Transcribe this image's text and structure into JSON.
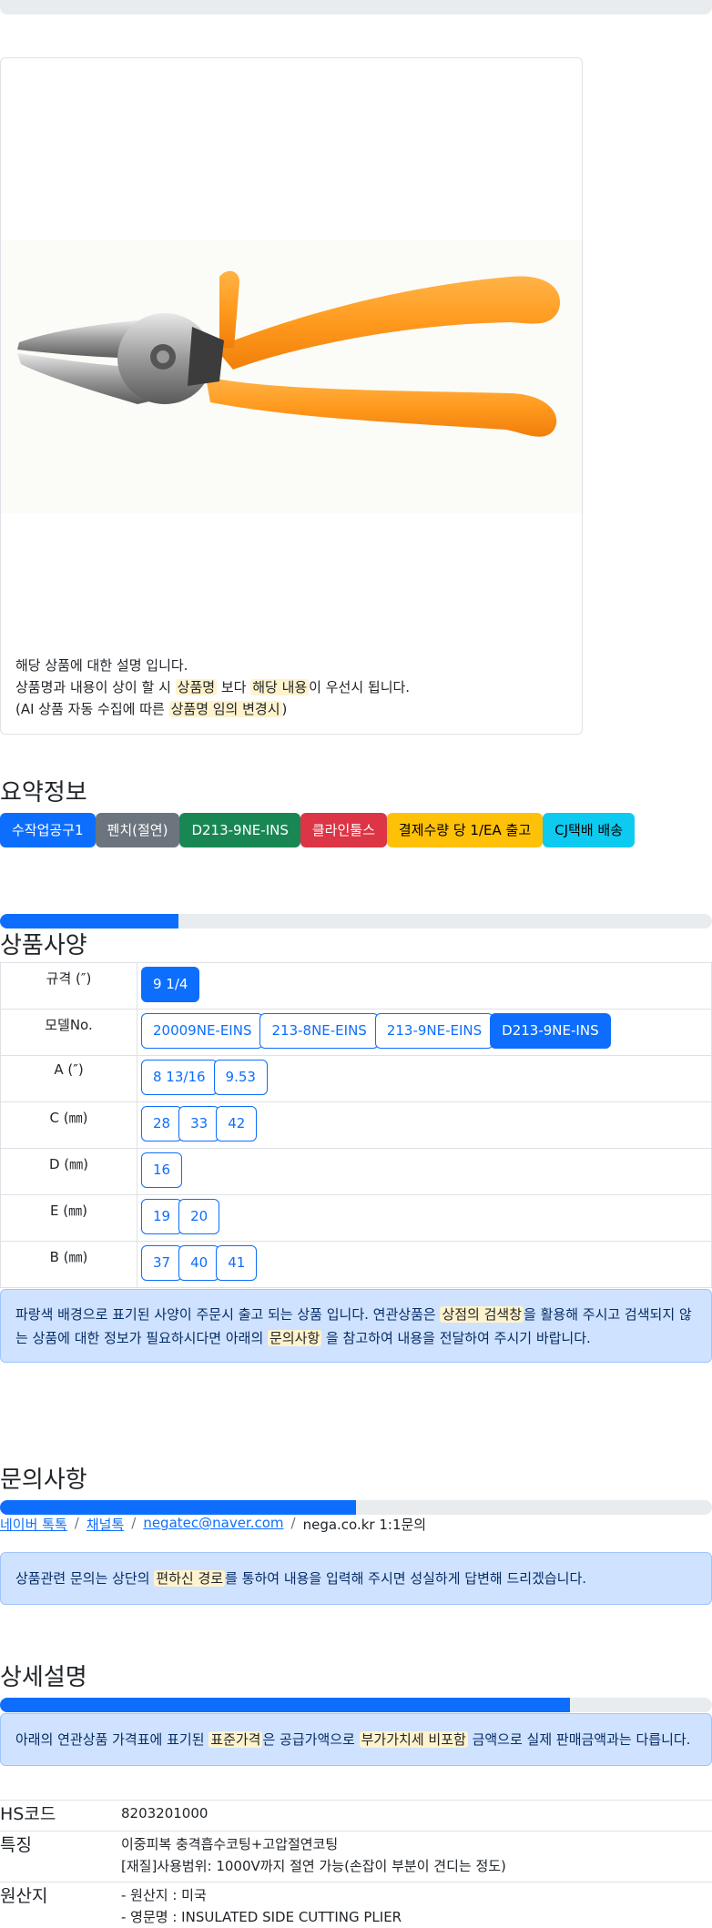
{
  "product": {
    "note_line1": "해당 상품에 대한 설명 입니다.",
    "note_line2_a": "상품명과 내용이 상이 할 시 ",
    "note_line2_mark1": "상품명",
    "note_line2_b": " 보다 ",
    "note_line2_mark2": "해당 내용",
    "note_line2_c": "이 우선시 됩니다.",
    "note_line3_a": "(AI 상품 자동 수집에 따른 ",
    "note_line3_mark": "상품명 임의 변경시",
    "note_line3_b": ")"
  },
  "summary": {
    "title": "요약정보",
    "badges": [
      {
        "label": "수작업공구1",
        "color": "#0d6efd",
        "text": "#ffffff"
      },
      {
        "label": "펜치(절연)",
        "color": "#6c757d",
        "text": "#ffffff"
      },
      {
        "label": "D213-9NE-INS",
        "color": "#198754",
        "text": "#ffffff"
      },
      {
        "label": "클라인툴스",
        "color": "#dc3545",
        "text": "#ffffff"
      },
      {
        "label": "결제수량 당 1/EA 출고",
        "color": "#ffc107",
        "text": "#000000"
      },
      {
        "label": "CJ택배 배송",
        "color": "#0dcaf0",
        "text": "#000000"
      }
    ]
  },
  "specs": {
    "title": "상품사양",
    "progress_fraction": 0.25,
    "rows": [
      {
        "label": "규격 (″)",
        "options": [
          "9 1/4"
        ],
        "selected": [
          0
        ]
      },
      {
        "label": "모델No.",
        "options": [
          "20009NE-EINS",
          "213-8NE-EINS",
          "213-9NE-EINS",
          "D213-9NE-INS"
        ],
        "selected": [
          3
        ]
      },
      {
        "label": "A (″)",
        "options": [
          "8 13/16",
          "9.53"
        ],
        "selected": []
      },
      {
        "label": "C (㎜)",
        "options": [
          "28",
          "33",
          "42"
        ],
        "selected": []
      },
      {
        "label": "D (㎜)",
        "options": [
          "16"
        ],
        "selected": []
      },
      {
        "label": "E (㎜)",
        "options": [
          "19",
          "20"
        ],
        "selected": []
      },
      {
        "label": "B (㎜)",
        "options": [
          "37",
          "40",
          "41"
        ],
        "selected": []
      }
    ],
    "notice_a": "파랑색 배경으로 표기된 사양이 주문시 출고 되는 상품 입니다. 연관상품은 ",
    "notice_mark1": "상점의 검색창",
    "notice_b": "을 활용해 주시고 검색되지 않는 상품에 대한 정보가 필요하시다면 아래의 ",
    "notice_mark2": "문의사항",
    "notice_c": " 을 참고하여 내용을 전달하여 주시기 바랍니다."
  },
  "inquiry": {
    "title": "문의사항",
    "progress_fraction": 0.5,
    "links": [
      "네이버 톡톡",
      "채널톡",
      "negatec@naver.com"
    ],
    "plain": "nega.co.kr 1:1문의",
    "separator": "/",
    "notice_a": "상품관련 문의는 상단의 ",
    "notice_mark": "편하신 경로",
    "notice_b": "를 통하여 내용을 입력해 주시면 성실하게 답변해 드리겠습니다."
  },
  "detail": {
    "title": "상세설명",
    "progress_fraction": 0.8,
    "notice_a": "아래의 연관상품 가격표에 표기된 ",
    "notice_mark1": "표준가격",
    "notice_b": "은 공급가액으로 ",
    "notice_mark2": "부가가치세 비포함",
    "notice_c": " 금액으로 실제 판매금액과는 다릅니다.",
    "rows": [
      {
        "key": "HS코드",
        "lines": [
          "8203201000"
        ]
      },
      {
        "key": "특징",
        "lines": [
          "이중피복 충격흡수코팅+고압절연코팅",
          "[재질]사용범위: 1000V까지 절연 가능(손잡이 부분이 견디는 정도)"
        ]
      },
      {
        "key": "원산지",
        "lines": [
          "- 원산지 : 미국",
          "- 영문명 : INSULATED SIDE CUTTING PLIER"
        ]
      }
    ]
  }
}
